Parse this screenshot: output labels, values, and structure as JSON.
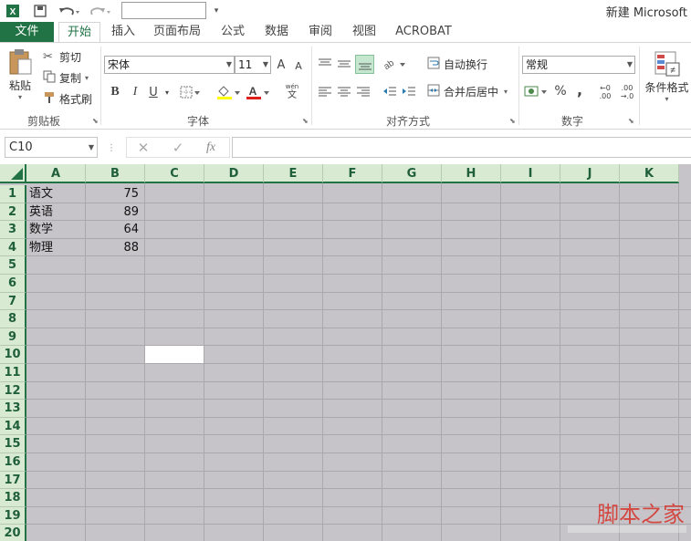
{
  "titlebar": {
    "window_title": "新建 Microsoft"
  },
  "tabs": [
    "文件",
    "开始",
    "插入",
    "页面布局",
    "公式",
    "数据",
    "审阅",
    "视图",
    "ACROBAT"
  ],
  "ribbon": {
    "clipboard": {
      "paste": "粘贴",
      "cut": "剪切",
      "copy": "复制",
      "format_painter": "格式刷",
      "label": "剪贴板"
    },
    "font": {
      "name": "宋体",
      "size": "11",
      "label": "字体",
      "bold": "B",
      "italic": "I",
      "underline": "U",
      "grow": "A",
      "shrink": "A",
      "wen": "文"
    },
    "alignment": {
      "wrap": "自动换行",
      "merge": "合并后居中",
      "label": "对齐方式"
    },
    "number": {
      "format": "常规",
      "label": "数字",
      "percent": "%",
      "comma": ",",
      "inc_dec": ".00",
      "dec_dec": ".00"
    },
    "styles": {
      "cond_format": "条件格式"
    }
  },
  "formula_bar": {
    "name_box": "C10",
    "fx": "fx",
    "cancel": "✕",
    "confirm": "✓"
  },
  "grid": {
    "columns": [
      "A",
      "B",
      "C",
      "D",
      "E",
      "F",
      "G",
      "H",
      "I",
      "J",
      "K"
    ],
    "rows": [
      "1",
      "2",
      "3",
      "4",
      "5",
      "6",
      "7",
      "8",
      "9",
      "10",
      "11",
      "12",
      "13",
      "14",
      "15",
      "16",
      "17",
      "18",
      "19",
      "20"
    ],
    "data": [
      {
        "a": "语文",
        "b": "75"
      },
      {
        "a": "英语",
        "b": "89"
      },
      {
        "a": "数学",
        "b": "64"
      },
      {
        "a": "物理",
        "b": "88"
      }
    ],
    "selected_cell": "C10"
  },
  "watermark": {
    "text": "脚本之家"
  },
  "colors": {
    "accent": "#217346",
    "grid_fill": "#c6c4c8",
    "header_fill": "#d9ead3"
  }
}
